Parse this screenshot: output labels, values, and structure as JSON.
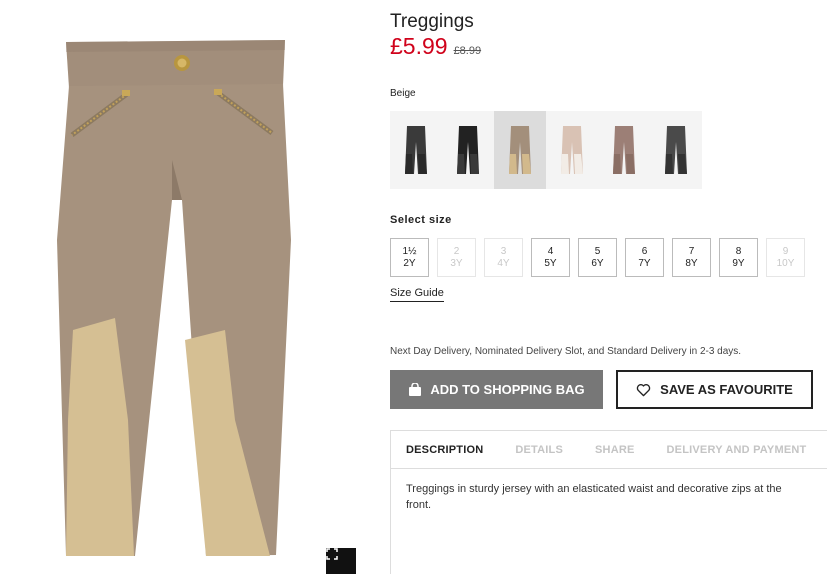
{
  "product": {
    "title": "Treggings",
    "price": "£5.99",
    "old_price": "£8.99"
  },
  "color": {
    "selected_label": "Beige",
    "swatches": [
      {
        "name": "dark grey",
        "color": "#3a3a3a",
        "knee": "#2a2a2a"
      },
      {
        "name": "black",
        "color": "#222222",
        "knee": "#3a3a3a"
      },
      {
        "name": "beige",
        "color": "#a38f7b",
        "knee": "#d2b98c"
      },
      {
        "name": "light pink",
        "color": "#d9c2b4",
        "knee": "#f2ece6"
      },
      {
        "name": "dusty floral",
        "color": "#9c7f76",
        "knee": "#8a6e64"
      },
      {
        "name": "charcoal",
        "color": "#4a4a4a",
        "knee": "#333333"
      }
    ],
    "selected_index": 2
  },
  "size": {
    "label": "Select size",
    "options": [
      {
        "line1": "1½",
        "line2": "2Y",
        "available": true
      },
      {
        "line1": "2",
        "line2": "3Y",
        "available": false
      },
      {
        "line1": "3",
        "line2": "4Y",
        "available": false
      },
      {
        "line1": "4",
        "line2": "5Y",
        "available": true
      },
      {
        "line1": "5",
        "line2": "6Y",
        "available": true
      },
      {
        "line1": "6",
        "line2": "7Y",
        "available": true
      },
      {
        "line1": "7",
        "line2": "8Y",
        "available": true
      },
      {
        "line1": "8",
        "line2": "9Y",
        "available": true
      },
      {
        "line1": "9",
        "line2": "10Y",
        "available": false
      }
    ],
    "guide_label": "Size Guide"
  },
  "delivery_note": "Next Day Delivery, Nominated Delivery Slot, and Standard Delivery in 2-3 days.",
  "actions": {
    "add_to_bag": "ADD TO SHOPPING BAG",
    "save_favourite": "SAVE AS FAVOURITE"
  },
  "info": {
    "tabs": [
      "DESCRIPTION",
      "DETAILS",
      "SHARE",
      "DELIVERY AND PAYMENT"
    ],
    "active_tab": 0,
    "description": "Treggings in sturdy jersey with an elasticated waist and decorative zips at the front."
  },
  "colors": {
    "price_red": "#d0021b",
    "bag_button_bg": "#777777"
  },
  "icons": {
    "bag": "shopping-bag-icon",
    "heart": "heart-outline-icon",
    "fullscreen": "fullscreen-icon"
  }
}
